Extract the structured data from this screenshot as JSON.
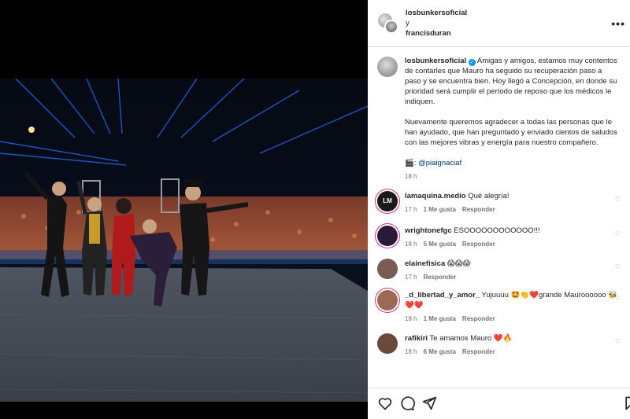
{
  "post": {
    "author": "losbunkersoficial",
    "conjunction": "y",
    "coauthor": "francisduran",
    "more_glyph": "•••"
  },
  "caption": {
    "username": "losbunkersoficial",
    "paragraph1": "Amigas y amigos, estamos muy contentos de contarles que Mauro ha seguido su recuperación paso a paso y se encuentra bien. Hoy llegó a Concepción, en donde su prioridad será cumplir el período de reposo que los médicos le indiquen.",
    "paragraph2": "Nuevamente queremos agradecer a todas las personas que le han ayudado, que han preguntado y enviado cientos de saludos con las mejores vibras y energía para nuestro compañero.",
    "credit_prefix": "🎬:",
    "credit_handle": "@piaignaciaf",
    "time": "18 h"
  },
  "comments": [
    {
      "username": "lamaquina.medio",
      "text": "Qué alegría!",
      "time": "17 h",
      "likes": "1 Me gusta",
      "reply": "Responder",
      "avatar_color": "#1a1a1a",
      "avatar_ring": "#d62976",
      "avatar_letters": "LM"
    },
    {
      "username": "wrightonefgc",
      "text": "ESOOOOOOOOOOOO!!!",
      "time": "18 h",
      "likes": "5 Me gusta",
      "reply": "Responder",
      "avatar_color": "#2a1a3a",
      "avatar_ring": "#d62976",
      "avatar_letters": ""
    },
    {
      "username": "elainefisica",
      "text": "😱😱😱",
      "time": "17 h",
      "likes": "",
      "reply": "Responder",
      "avatar_color": "#7a5a52",
      "avatar_ring": "",
      "avatar_letters": ""
    },
    {
      "username": "_d_libertad_y_amor_",
      "text": "Yujuuuu 🤩👏❤️grande Mauroooooo 🐝 ❤️❤️",
      "time": "18 h",
      "likes": "1 Me gusta",
      "reply": "Responder",
      "avatar_color": "#9a6a55",
      "avatar_ring": "#d62976",
      "avatar_letters": ""
    },
    {
      "username": "rafikiri",
      "text": "Te amamos Mauro ❤️🔥",
      "time": "18 h",
      "likes": "6 Me gusta",
      "reply": "Responder",
      "avatar_color": "#6a4a3a",
      "avatar_ring": "",
      "avatar_letters": ""
    }
  ],
  "actions": {
    "like_icon": "heart-outline-icon",
    "comment_icon": "comment-bubble-icon",
    "share_icon": "paper-plane-icon",
    "save_icon": "bookmark-icon"
  },
  "colors": {
    "verified": "#0095f6",
    "meta_text": "#737373",
    "primary_text": "#262626",
    "border": "#dbdbdb"
  }
}
